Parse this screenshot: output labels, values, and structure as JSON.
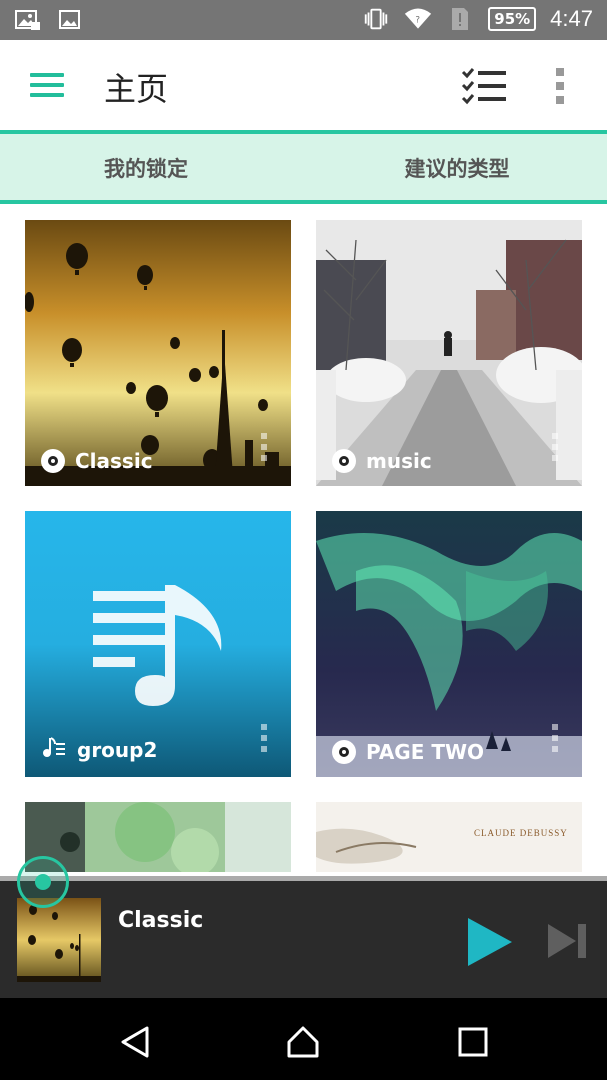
{
  "status_bar": {
    "icons_left": [
      "gallery-icon",
      "image-icon"
    ],
    "icons_right": [
      "vibrate-icon",
      "wifi-icon",
      "sim-icon"
    ],
    "battery": "95%",
    "time": "4:47"
  },
  "app_bar": {
    "title": "主页",
    "menu_icon": "hamburger-icon",
    "action_icon": "checklist-icon",
    "overflow_icon": "more-vert-icon"
  },
  "tabs": [
    {
      "label": "我的锁定",
      "selected": true
    },
    {
      "label": "建议的类型",
      "selected": false
    }
  ],
  "cards": [
    {
      "label": "Classic",
      "type_icon": "disc-icon"
    },
    {
      "label": "music",
      "type_icon": "disc-icon"
    },
    {
      "label": "group2",
      "type_icon": "playlist-icon"
    },
    {
      "label": "PAGE TWO",
      "type_icon": "disc-icon"
    },
    {
      "label": "",
      "type_icon": ""
    },
    {
      "label": "CLAUDE DEBUSSY",
      "type_icon": ""
    }
  ],
  "now_playing": {
    "title": "Classic",
    "play_icon": "play-icon",
    "next_icon": "skip-next-icon"
  },
  "colors": {
    "accent": "#27c6a1",
    "tab_bg": "#d7f4e8",
    "status_bar": "#757575",
    "player_bg": "#2b2b2b",
    "play_button": "#1fb7c4"
  }
}
